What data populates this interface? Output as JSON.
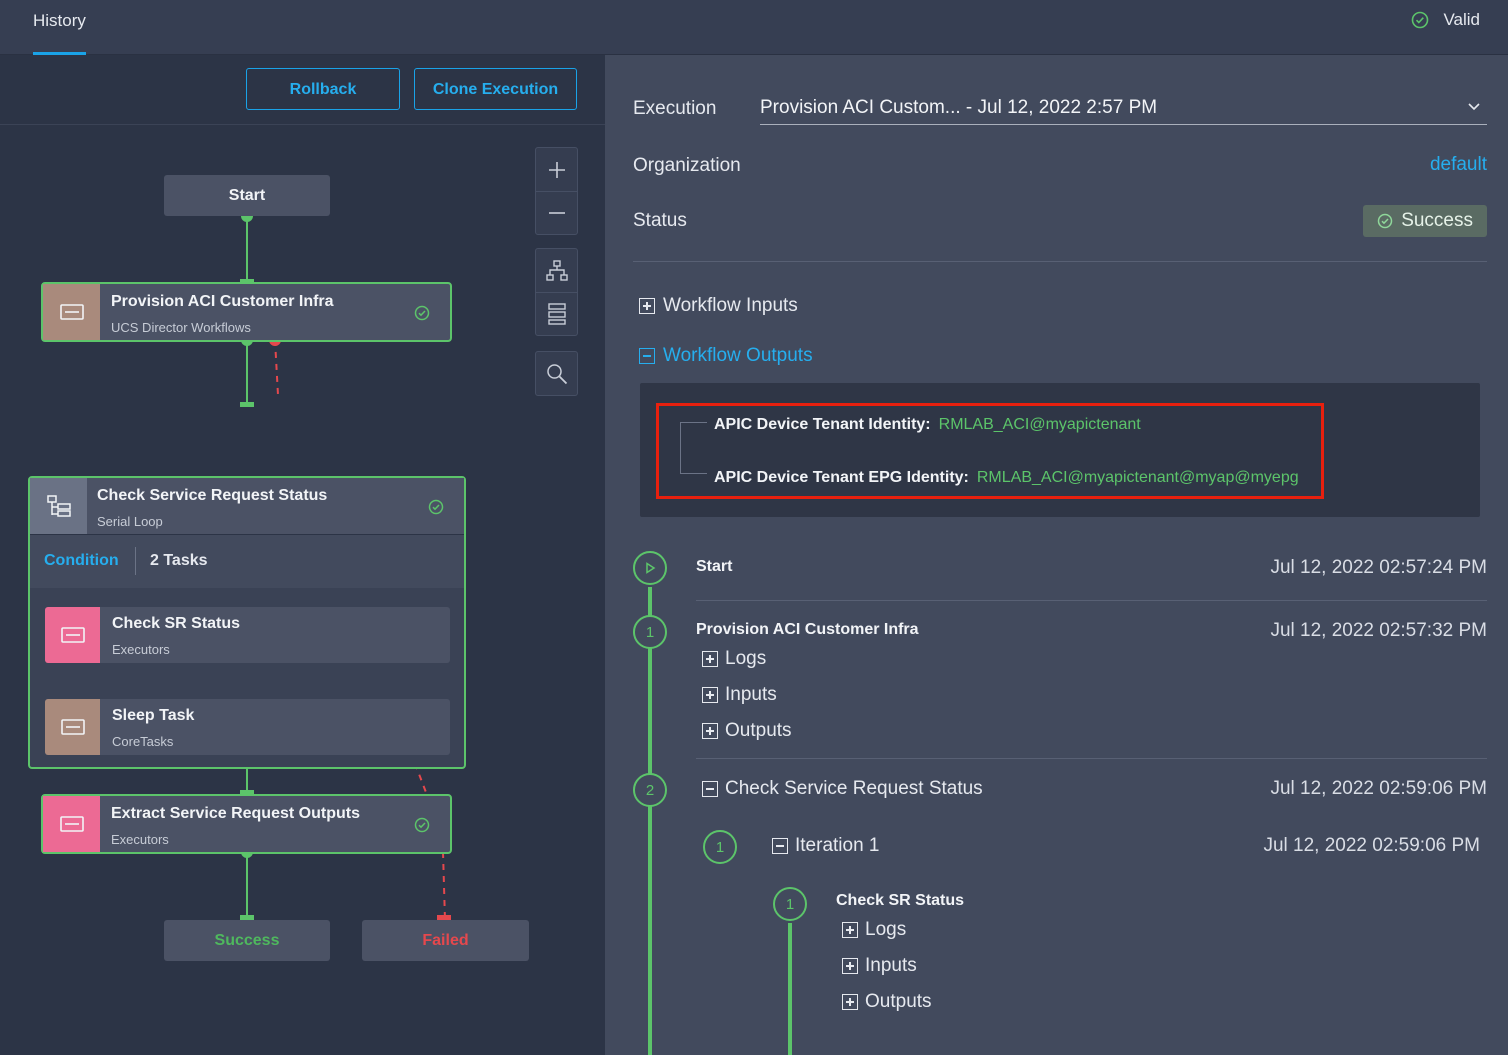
{
  "topbar": {
    "tab": "History",
    "valid_label": "Valid"
  },
  "toolbar": {
    "rollback": "Rollback",
    "clone": "Clone Execution"
  },
  "canvas": {
    "start": "Start",
    "success": "Success",
    "failed": "Failed",
    "nodes": {
      "provision": {
        "title": "Provision ACI Customer Infra",
        "sub": "UCS Director Workflows"
      },
      "check_loop": {
        "title": "Check Service Request Status",
        "sub": "Serial Loop",
        "condition": "Condition",
        "tasks": "2 Tasks"
      },
      "check_sr": {
        "title": "Check SR Status",
        "sub": "Executors"
      },
      "sleep": {
        "title": "Sleep Task",
        "sub": "CoreTasks"
      },
      "extract": {
        "title": "Extract Service Request Outputs",
        "sub": "Executors"
      }
    }
  },
  "details": {
    "execution_label": "Execution",
    "execution_value": "Provision ACI Custom... - Jul 12, 2022 2:57 PM",
    "organization_label": "Organization",
    "organization_value": "default",
    "status_label": "Status",
    "status_value": "Success",
    "workflow_inputs": "Workflow Inputs",
    "workflow_outputs": "Workflow Outputs",
    "outputs": [
      {
        "key": "APIC Device Tenant Identity:",
        "value": "RMLAB_ACI@myapictenant"
      },
      {
        "key": "APIC Device Tenant EPG Identity:",
        "value": "RMLAB_ACI@myapictenant@myap@myepg"
      }
    ]
  },
  "timeline": {
    "start": {
      "title": "Start",
      "time": "Jul 12, 2022 02:57:24 PM"
    },
    "step1": {
      "num": "1",
      "title": "Provision ACI Customer Infra",
      "time": "Jul 12, 2022 02:57:32 PM",
      "logs": "Logs",
      "inputs": "Inputs",
      "outputs": "Outputs"
    },
    "step2": {
      "num": "2",
      "title": "Check Service Request Status",
      "time": "Jul 12, 2022 02:59:06 PM"
    },
    "iteration": {
      "num": "1",
      "title": "Iteration 1",
      "time": "Jul 12, 2022 02:59:06 PM"
    },
    "sub1": {
      "num": "1",
      "title": "Check SR Status",
      "logs": "Logs",
      "inputs": "Inputs",
      "outputs": "Outputs"
    }
  },
  "colors": {
    "accent": "#1aa3e8",
    "success": "#5cc46a",
    "failed": "#e5484d",
    "highlight": "#e8200e"
  }
}
